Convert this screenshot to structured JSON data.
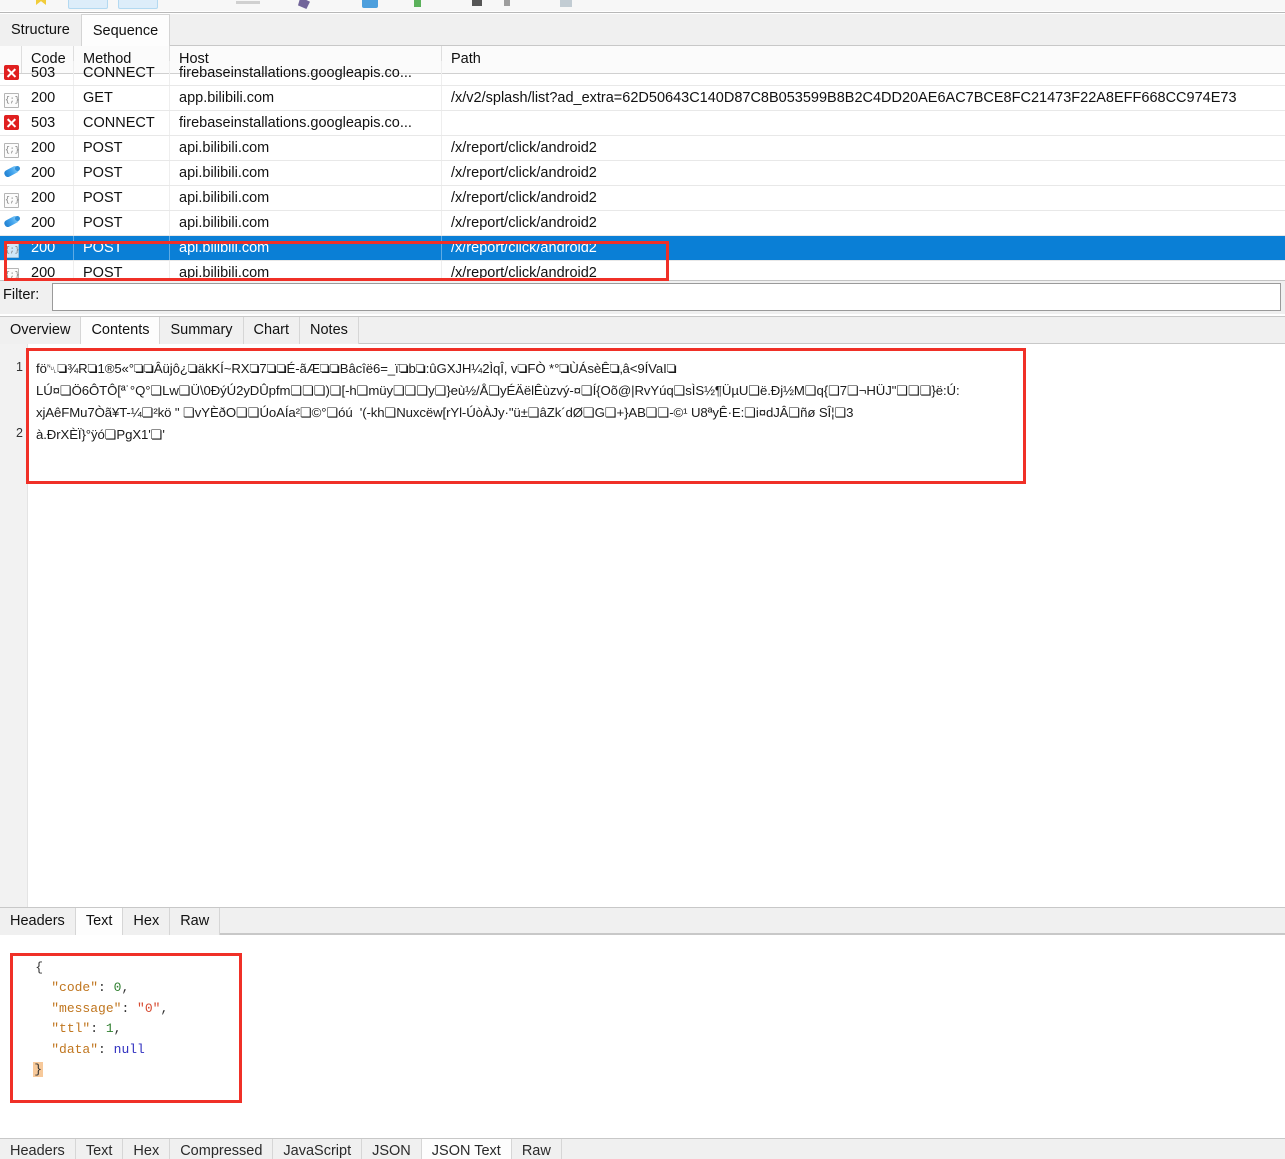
{
  "toolbar": {
    "icons": [
      "bookmark-icon",
      "tool-button-1",
      "tool-button-2",
      "divider-icon",
      "settings-icon",
      "throttle-icon",
      "record-icon",
      "clear-icon",
      "breakpoint-icon",
      "map-icon"
    ]
  },
  "top_tabs": [
    {
      "label": "Structure",
      "active": false
    },
    {
      "label": "Sequence",
      "active": true
    }
  ],
  "table": {
    "columns": [
      "",
      "Code",
      "Method",
      "Host",
      "Path"
    ],
    "rows": [
      {
        "icon": "error-icon",
        "code": "503",
        "method": "CONNECT",
        "host": "firebaseinstallations.googleapis.co...",
        "path": "",
        "selected": false,
        "clipped_top": true
      },
      {
        "icon": "json-icon",
        "code": "200",
        "method": "GET",
        "host": "app.bilibili.com",
        "path": "/x/v2/splash/list?ad_extra=62D50643C140D87C8B053599B8B2C4DD20AE6AC7BCE8FC21473F22A8EFF668CC974E73",
        "selected": false
      },
      {
        "icon": "error-icon",
        "code": "503",
        "method": "CONNECT",
        "host": "firebaseinstallations.googleapis.co...",
        "path": "",
        "selected": false
      },
      {
        "icon": "json-icon",
        "code": "200",
        "method": "POST",
        "host": "api.bilibili.com",
        "path": "/x/report/click/android2",
        "selected": false
      },
      {
        "icon": "pen-icon",
        "code": "200",
        "method": "POST",
        "host": "api.bilibili.com",
        "path": "/x/report/click/android2",
        "selected": false
      },
      {
        "icon": "json-icon",
        "code": "200",
        "method": "POST",
        "host": "api.bilibili.com",
        "path": "/x/report/click/android2",
        "selected": false
      },
      {
        "icon": "pen-icon",
        "code": "200",
        "method": "POST",
        "host": "api.bilibili.com",
        "path": "/x/report/click/android2",
        "selected": false
      },
      {
        "icon": "json-icon",
        "code": "200",
        "method": "POST",
        "host": "api.bilibili.com",
        "path": "/x/report/click/android2",
        "selected": true
      },
      {
        "icon": "json-icon",
        "code": "200",
        "method": "POST",
        "host": "api.bilibili.com",
        "path": "/x/report/click/android2",
        "selected": false,
        "clipped_bottom": true
      }
    ]
  },
  "filter": {
    "label": "Filter:",
    "value": "",
    "placeholder": ""
  },
  "middle_tabs": [
    {
      "label": "Overview",
      "active": false
    },
    {
      "label": "Contents",
      "active": true
    },
    {
      "label": "Summary",
      "active": false
    },
    {
      "label": "Chart",
      "active": false
    },
    {
      "label": "Notes",
      "active": false
    }
  ],
  "content_viewer": {
    "line_numbers": [
      "1",
      "2"
    ],
    "lines": [
      "fö␀❏¾R❏1®5«°❏❏Âüjô¿❏äkKÍ~RX❏7❏❏É-ãÆ❏❏Bâcîë6=_ï❏b❏:ûGXJH¼2ÌqÎ, v❏FÒ *°❏ÙÁsèÊ❏‚â<9ÍVaI❏",
      "LÚ¤❏Ö6ÔTÔ[ª˙°Q°❏Lw❏Ü\\0ÐýÚ2yDÛpfm❏❏❏)❏[-h❏müy❏❏❏y❏}eù½/Å❏yÉÄëlÊùzvý-¤❏Í{Oõ@|RvYúq❏sÌS½¶ÜµU❏ë.Ðj½M❏q{❏7❏¬HÜJ\"❏❏❏}ë:Ú:",
      "xjAêFMu7Òã¥T-¼❏²kö \" ❏vYÈðO❏❏ÚoAÍa²❏©°❏óú  '(-kh❏Nuxcëw[rYl-ÚòÀJy·\"ü±❏âZk´dØ❏G❏+}AB❏❏-©¹ U8ªyÊ·E:❏i¤dJÂ❏ñø SÎ¦❏3",
      "à.ÐrXÈÏ}°ÿó❏PgX1'❏'"
    ]
  },
  "response_tabs": [
    {
      "label": "Headers",
      "active": false
    },
    {
      "label": "Text",
      "active": true
    },
    {
      "label": "Hex",
      "active": false
    },
    {
      "label": "Raw",
      "active": false
    }
  ],
  "json_response": {
    "open_brace": "{",
    "close_brace": "}",
    "entries": [
      {
        "key": "\"code\"",
        "value": "0",
        "type": "num",
        "comma": ","
      },
      {
        "key": "\"message\"",
        "value": "\"0\"",
        "type": "str",
        "comma": ","
      },
      {
        "key": "\"ttl\"",
        "value": "1",
        "type": "num",
        "comma": ","
      },
      {
        "key": "\"data\"",
        "value": "null",
        "type": "null",
        "comma": ""
      }
    ]
  },
  "bottom_tabs": [
    {
      "label": "Headers",
      "active": false
    },
    {
      "label": "Text",
      "active": false
    },
    {
      "label": "Hex",
      "active": false
    },
    {
      "label": "Compressed",
      "active": false
    },
    {
      "label": "JavaScript",
      "active": false
    },
    {
      "label": "JSON",
      "active": false
    },
    {
      "label": "JSON Text",
      "active": true
    },
    {
      "label": "Raw",
      "active": false
    }
  ],
  "annotations": {
    "color": "#f03027",
    "boxes": [
      "selected-request-row",
      "binary-content-block",
      "json-response-block"
    ]
  }
}
